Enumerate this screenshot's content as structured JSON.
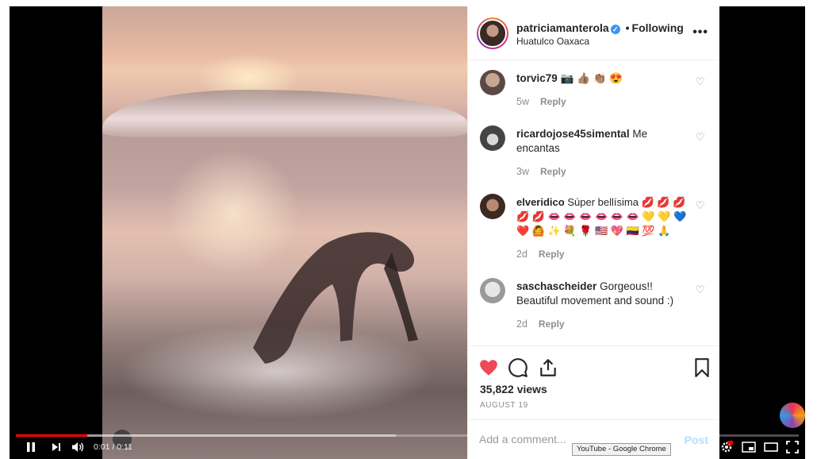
{
  "post": {
    "username": "patriciamanterola",
    "separator": "•",
    "follow_status": "Following",
    "location": "Huatulco Oaxaca",
    "more": "•••"
  },
  "comments": [
    {
      "user": "torvic79",
      "text": "📷 👍🏽 👏🏽 😍",
      "age": "5w",
      "reply": "Reply"
    },
    {
      "user": "ricardojose45simental",
      "text": "Me encantas",
      "age": "3w",
      "reply": "Reply"
    },
    {
      "user": "elveridico",
      "text": "Súper bellísima 💋 💋 💋 💋 💋 👄 👄 👄 👄 👄 👄 💛 💛 💙 ❤️ 🙆 ✨ 💐 🌹 🇺🇸 💖 🇨🇴 💯 🙏",
      "age": "2d",
      "reply": "Reply"
    },
    {
      "user": "saschascheider",
      "text": "Gorgeous!! Beautiful movement and sound :)",
      "age": "2d",
      "reply": "Reply"
    }
  ],
  "stats": {
    "views": "35,822 views",
    "date": "AUGUST 19"
  },
  "add_comment": {
    "placeholder": "Add a comment...",
    "post_label": "Post"
  },
  "player": {
    "time": "0:01 / 0:11",
    "progress": 0.091,
    "buffered": 0.485,
    "tooltip": "YouTube - Google Chrome"
  },
  "colors": {
    "like_red": "#ed4956",
    "verified_blue": "#3897f0",
    "progress_red": "#ff0000"
  }
}
